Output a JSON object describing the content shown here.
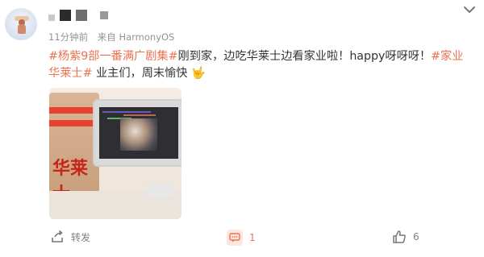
{
  "post": {
    "time": "11分钟前",
    "source": "来自 HarmonyOS",
    "content": {
      "topic1": "#杨紫9部一番满广剧集#",
      "text1": "刚到家，边吃华莱士边看家业啦！happy呀呀呀！",
      "topic2": "#家业 华莱士#",
      "text2": " 业主们，周末愉快",
      "emoji": "🤟"
    },
    "image": {
      "bag_text": "华莱士"
    }
  },
  "actions": {
    "share_label": "转发",
    "comment_count": "1",
    "like_count": "6"
  },
  "colors": {
    "topic": "#eb7350",
    "meta_text": "#939393"
  },
  "icons": {
    "avatar": "avatar",
    "chevron": "chevron-down-icon",
    "share": "share-icon",
    "comment": "comment-icon",
    "like": "like-icon"
  }
}
